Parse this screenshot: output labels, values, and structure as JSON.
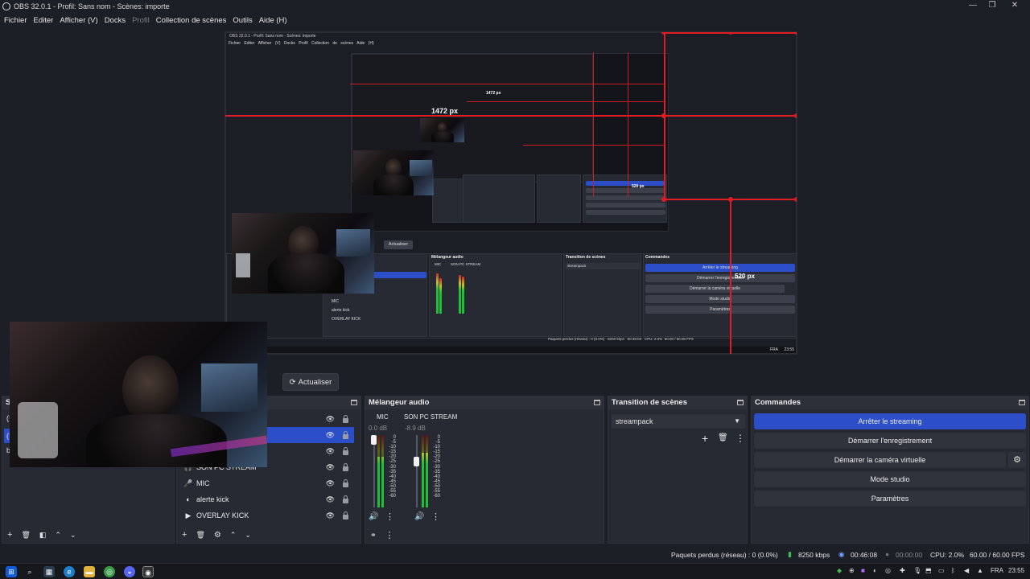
{
  "window": {
    "title": "OBS 32.0.1 - Profil: Sans nom - Scènes: importe",
    "minimize": "—",
    "restore": "❐",
    "close": "✕"
  },
  "menu": {
    "items": [
      "Fichier",
      "Editer",
      "Afficher (V)",
      "Docks",
      "Profil",
      "Collection de scènes",
      "Outils",
      "Aide (H)"
    ],
    "disabled_index": 4
  },
  "preview": {
    "size_labels": {
      "main_width": "1472 px",
      "main_height": "520 px",
      "inner_width": "1472 px",
      "inner_height": "520 px"
    },
    "inner": {
      "title": "OBS 32.0.1 - Profil: Sans nom - Scènes: importe",
      "menu": [
        "Fichier",
        "Editer",
        "Afficher (V)",
        "Docks",
        "Profil",
        "Collection de scènes",
        "Aide (H)"
      ],
      "actualiser": "Actualiser",
      "audio_title": "Mélangeur audio",
      "transition_title": "Transition de scènes",
      "commands_title": "Commandes",
      "mic": "MIC",
      "son_pc": "SON PC STREAM",
      "transition": "streampack",
      "sources": [
        "MIC",
        "alerte kick",
        "OVERLAY KICK"
      ],
      "cmd_buttons": [
        "Arrêter le streaming",
        "Démarrer l'enregistrement",
        "Démarrer la caméra virtuelle",
        "Mode studio",
        "Paramètres"
      ],
      "status": [
        "Paquets perdus (réseau) : 0 (0.0%)",
        "8250 kbps",
        "00:46:03",
        "CPU: 2.0%",
        "60.00 / 60.00 FPS"
      ],
      "tray": [
        "FRA",
        "23:55"
      ]
    }
  },
  "toolbar": {
    "actualiser": "Actualiser"
  },
  "scenes_dock": {
    "title_partial": "Sc",
    "rows": [
      "(!",
      "(!",
      "b"
    ]
  },
  "sources_dock": {
    "rows": [
      {
        "icon": "",
        "label": "",
        "selected": false
      },
      {
        "icon": "",
        "label": "",
        "selected": true
      },
      {
        "icon": "",
        "label": "",
        "selected": false
      },
      {
        "icon": "🎧",
        "label": "SON PC STREAM",
        "selected": false
      },
      {
        "icon": "🎤",
        "label": "MIC",
        "selected": false
      },
      {
        "icon": "◐",
        "label": "alerte kick",
        "selected": false
      },
      {
        "icon": "▶",
        "label": "OVERLAY KICK",
        "selected": false
      }
    ]
  },
  "audio_mixer": {
    "title": "Mélangeur audio",
    "channels": [
      {
        "name": "MIC",
        "db": "0.0 dB",
        "level": 0.7,
        "fader": 1.0
      },
      {
        "name": "SON PC STREAM",
        "db": "-8.9 dB",
        "level": 0.75,
        "fader": 0.65
      }
    ],
    "ticks": [
      "0",
      "-5",
      "-10",
      "-15",
      "-20",
      "-25",
      "-30",
      "-35",
      "-40",
      "-45",
      "-50",
      "-55",
      "-60"
    ]
  },
  "transition": {
    "title": "Transition de scènes",
    "selected": "streampack"
  },
  "commands": {
    "title": "Commandes",
    "buttons": [
      "Arrêter le streaming",
      "Démarrer l'enregistrement",
      "Démarrer la caméra virtuelle",
      "Mode studio",
      "Paramètres"
    ]
  },
  "status": {
    "dropped": "Paquets perdus (réseau) : 0 (0.0%)",
    "bitrate": "8250 kbps",
    "stream_time": "00:46:08",
    "rec_time": "00:00:00",
    "cpu": "CPU: 2.0%",
    "fps": "60.00 / 60.00 FPS"
  },
  "taskbar": {
    "lang": "FRA",
    "time": "23:55"
  },
  "colors": {
    "bg": "#1d1f26",
    "panel": "#272a33",
    "accent": "#2c4fc9",
    "red": "#e01c24"
  }
}
